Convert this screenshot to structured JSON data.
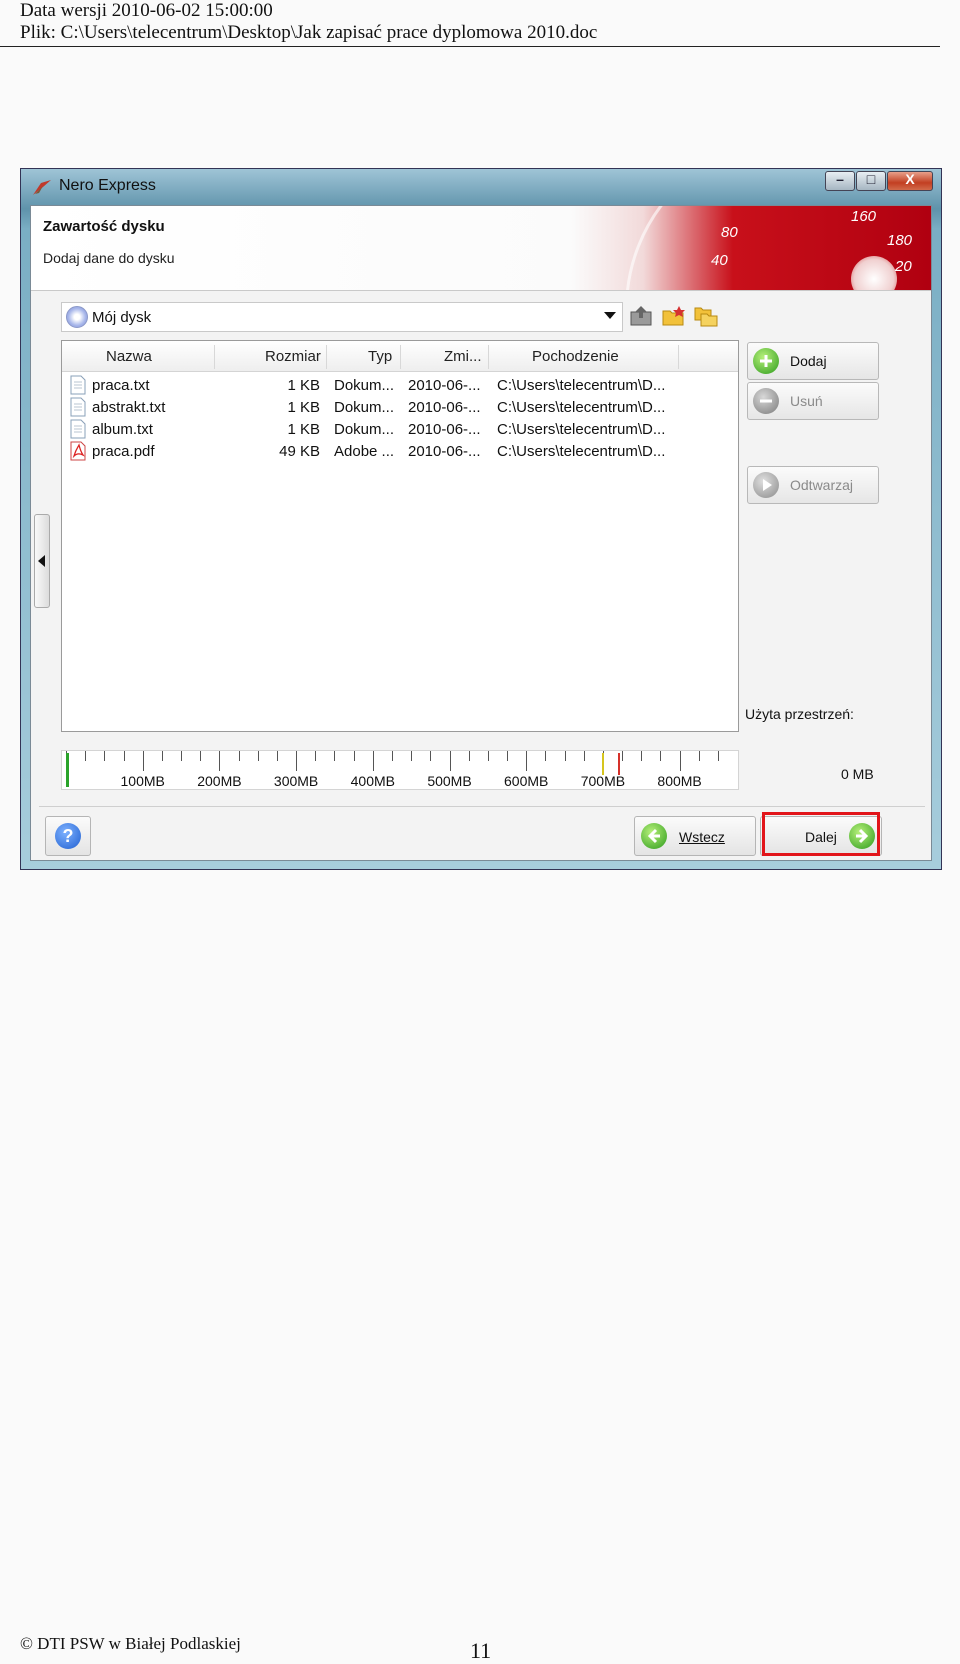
{
  "doc": {
    "header_line1": "Data wersji 2010-06-02 15:00:00",
    "header_line2": "Plik: C:\\Users\\telecentrum\\Desktop\\Jak zapisać prace dyplomowa 2010.doc",
    "footer_left": "© DTI PSW w Białej Podlaskiej",
    "page_number": "11"
  },
  "window": {
    "title": "Nero Express",
    "controls": {
      "minimize": "–",
      "maximize": "□",
      "close": "X"
    }
  },
  "banner": {
    "title": "Zawartość dysku",
    "subtitle": "Dodaj dane do dysku",
    "gauge_numbers": [
      "160",
      "180",
      "20",
      "80",
      "40"
    ]
  },
  "combo": {
    "value": "Mój dysk"
  },
  "list": {
    "columns": [
      "Nazwa",
      "Rozmiar",
      "Typ",
      "Zmi...",
      "Pochodzenie"
    ],
    "rows": [
      {
        "name": "praca.txt",
        "size": "1 KB",
        "type": "Dokum...",
        "modified": "2010-06-...",
        "origin": "C:\\Users\\telecentrum\\D..."
      },
      {
        "name": "abstrakt.txt",
        "size": "1 KB",
        "type": "Dokum...",
        "modified": "2010-06-...",
        "origin": "C:\\Users\\telecentrum\\D..."
      },
      {
        "name": "album.txt",
        "size": "1 KB",
        "type": "Dokum...",
        "modified": "2010-06-...",
        "origin": "C:\\Users\\telecentrum\\D..."
      },
      {
        "name": "praca.pdf",
        "size": "49 KB",
        "type": "Adobe ...",
        "modified": "2010-06-...",
        "origin": "C:\\Users\\telecentrum\\D..."
      }
    ]
  },
  "side": {
    "add": "Dodaj",
    "remove": "Usuń",
    "play": "Odtwarzaj",
    "used_label": "Użyta przestrzeń:",
    "used_value": "0 MB"
  },
  "ruler": {
    "labels": [
      "100MB",
      "200MB",
      "300MB",
      "400MB",
      "500MB",
      "600MB",
      "700MB",
      "800MB"
    ]
  },
  "nav": {
    "help": "?",
    "back": "Wstecz",
    "next": "Dalej"
  },
  "colors": {
    "highlight": "#e2151a",
    "banner_red": "#c8101a",
    "green_go": "#2d9b1c"
  }
}
